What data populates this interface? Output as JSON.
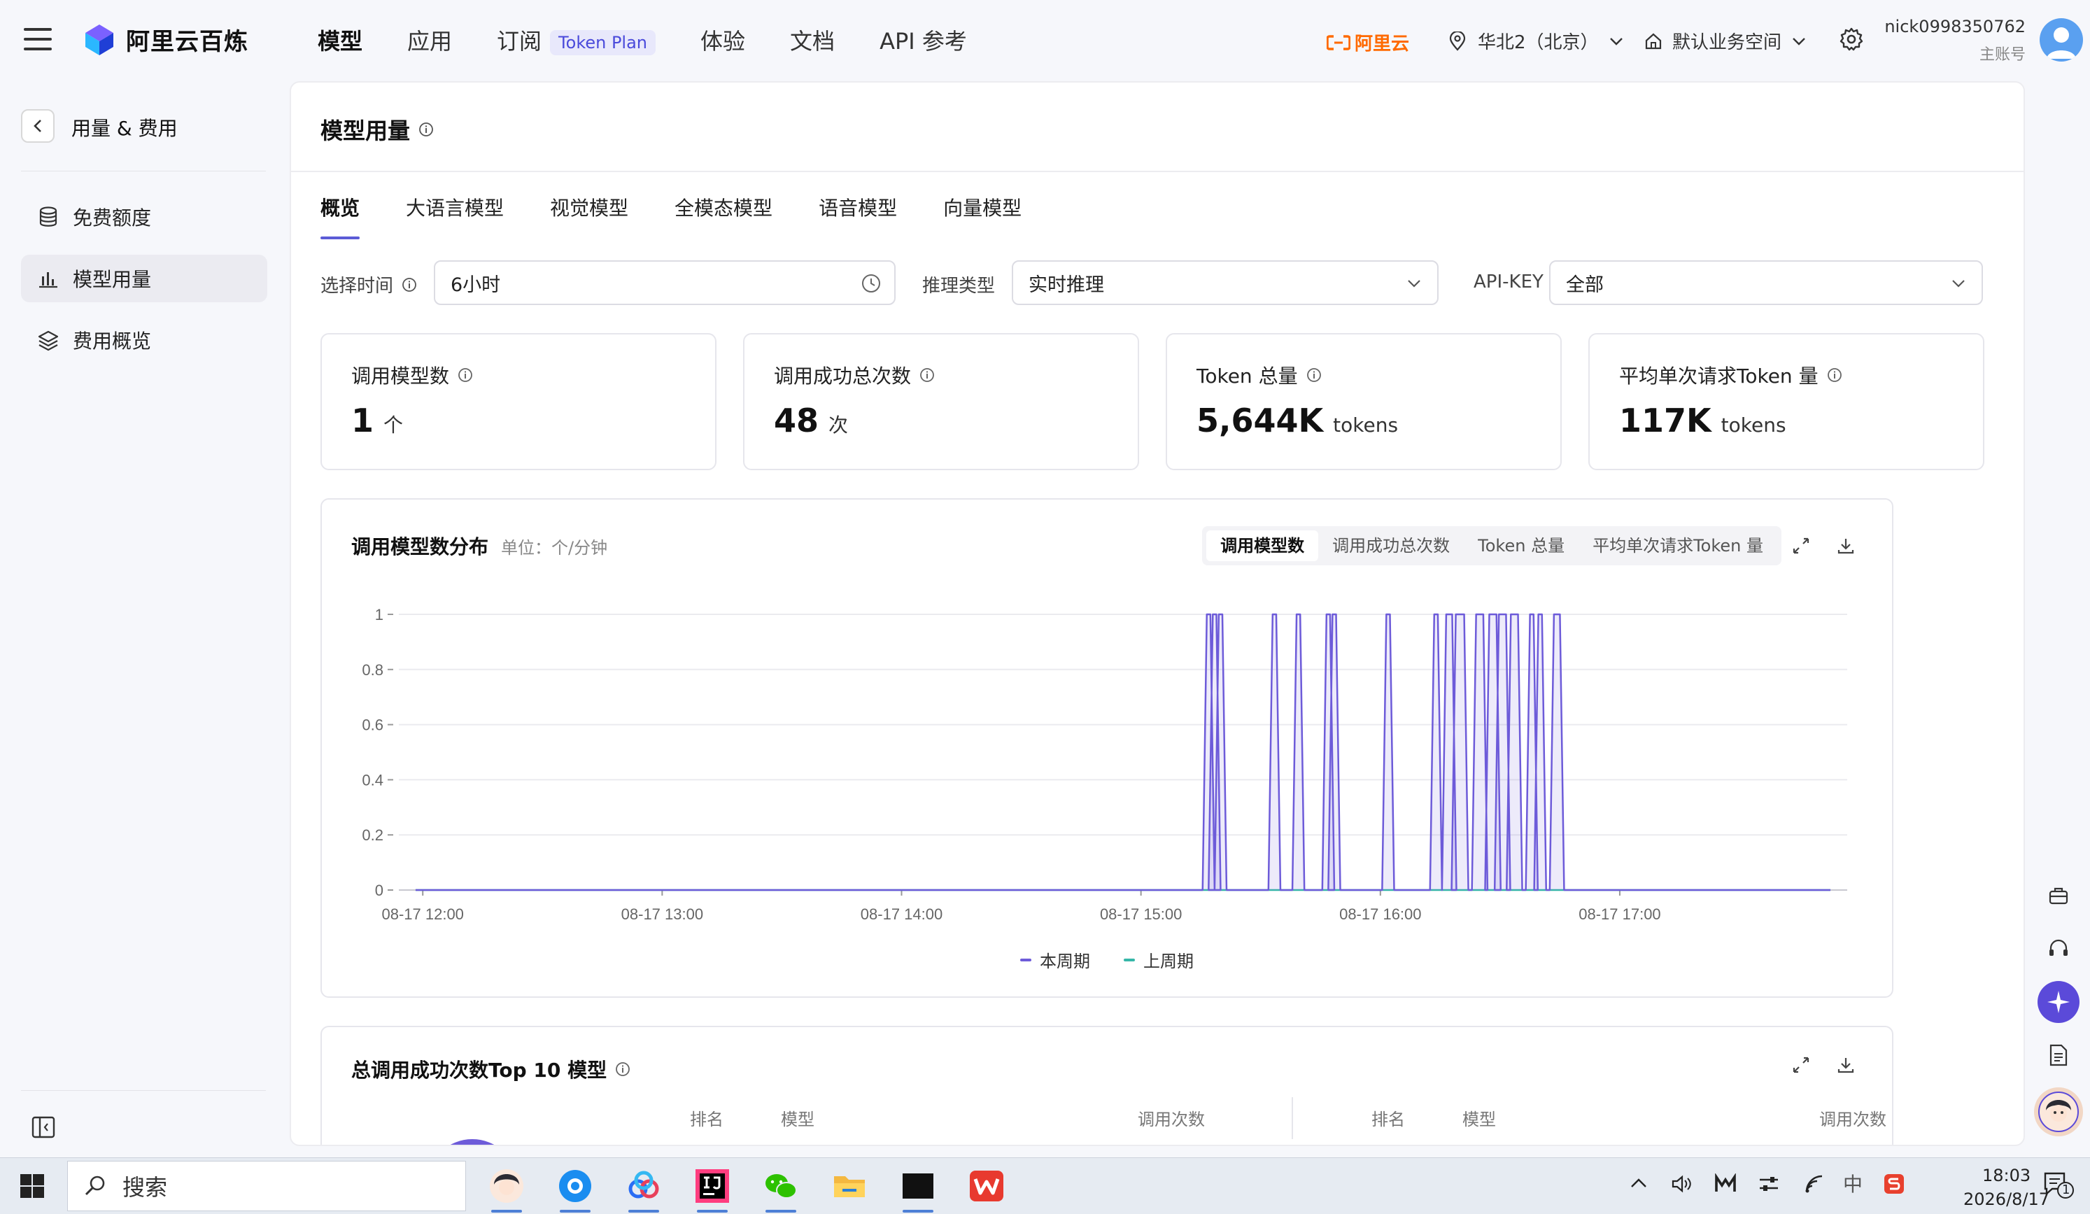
{
  "topbar": {
    "brand": "阿里云百炼",
    "nav": [
      "模型",
      "应用",
      "订阅",
      "体验",
      "文档",
      "API 参考"
    ],
    "plan_badge": "Token Plan",
    "aliyun": "阿里云",
    "region": "华北2（北京）",
    "workspace": "默认业务空间",
    "username": "nick0998350762",
    "role": "主账号"
  },
  "sidebar": {
    "title": "用量 & 费用",
    "items": [
      "免费额度",
      "模型用量",
      "费用概览"
    ],
    "active": "模型用量"
  },
  "main": {
    "title": "模型用量",
    "tabs": [
      "概览",
      "大语言模型",
      "视觉模型",
      "全模态模型",
      "语音模型",
      "向量模型"
    ],
    "filters": {
      "time_label": "选择时间",
      "time_value": "6小时",
      "type_label": "推理类型",
      "type_value": "实时推理",
      "key_label": "API-KEY",
      "key_value": "全部"
    },
    "stats": [
      {
        "label": "调用模型数",
        "value": "1",
        "unit": "个"
      },
      {
        "label": "调用成功总次数",
        "value": "48",
        "unit": "次"
      },
      {
        "label": "Token 总量",
        "value": "5,644K",
        "unit": "tokens"
      },
      {
        "label": "平均单次请求Token 量",
        "value": "117K",
        "unit": "tokens"
      }
    ],
    "chart_card": {
      "title": "调用模型数分布",
      "unit": "单位：个/分钟",
      "segments": [
        "调用模型数",
        "调用成功总次数",
        "Token 总量",
        "平均单次请求Token 量"
      ],
      "active_segment": "调用模型数"
    },
    "top10": {
      "title": "总调用成功次数Top 10 模型",
      "headers_left": [
        "排名",
        "模型",
        "调用次数"
      ],
      "headers_right": [
        "排名",
        "模型",
        "调用次数"
      ]
    }
  },
  "chart_data": {
    "type": "line",
    "ylim": [
      0,
      1
    ],
    "yticks": [
      "0",
      "0.2",
      "0.4",
      "0.6",
      "0.8",
      "1"
    ],
    "xticks": [
      "08-17 12:00",
      "08-17 13:00",
      "08-17 14:00",
      "08-17 15:00",
      "08-17 16:00",
      "08-17 17:00"
    ],
    "x_start_hour": 11.9,
    "x_end_hour": 17.95,
    "series": [
      {
        "name": "本周期",
        "color": "#6d5bd9",
        "bursts": [
          [
            15.275,
            15.29
          ],
          [
            15.3,
            15.315
          ],
          [
            15.325,
            15.34
          ],
          [
            15.55,
            15.565
          ],
          [
            15.65,
            15.665
          ],
          [
            15.775,
            15.79
          ],
          [
            15.8,
            15.815
          ],
          [
            16.025,
            16.04
          ],
          [
            16.225,
            16.24
          ],
          [
            16.275,
            16.3
          ],
          [
            16.315,
            16.35
          ],
          [
            16.4,
            16.43
          ],
          [
            16.455,
            16.485
          ],
          [
            16.495,
            16.525
          ],
          [
            16.545,
            16.575
          ],
          [
            16.625,
            16.64
          ],
          [
            16.66,
            16.675
          ],
          [
            16.725,
            16.75
          ]
        ]
      },
      {
        "name": "上周期",
        "color": "#36b7a8",
        "bursts": []
      }
    ],
    "grid": true,
    "legend_position": "bottom-center"
  },
  "taskbar": {
    "search": "搜索",
    "time": "18:03",
    "date": "2026/8/17",
    "ime": "中",
    "notifications": "1"
  }
}
